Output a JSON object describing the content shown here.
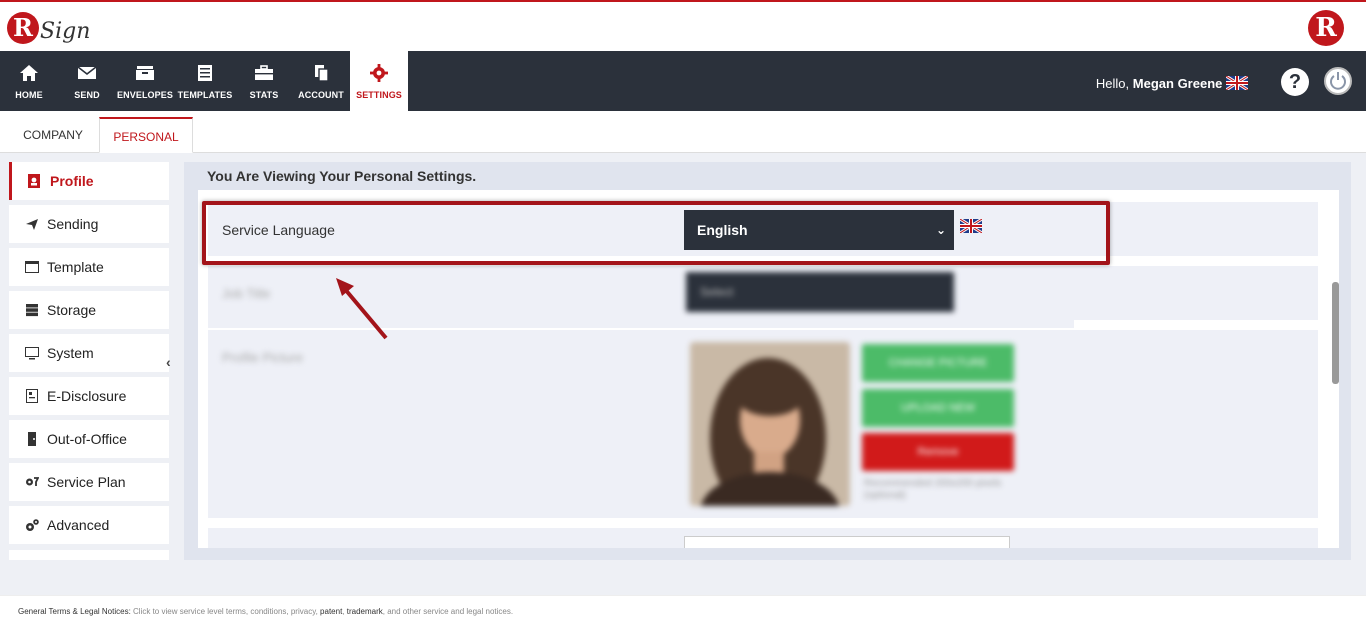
{
  "brand": {
    "left_logo_initial": "R",
    "left_logo_text": "Sign",
    "right_logo_initial": "R",
    "accent": "#c0171c"
  },
  "nav": {
    "items": [
      {
        "label": "HOME",
        "icon": "home-icon"
      },
      {
        "label": "SEND",
        "icon": "envelope-icon"
      },
      {
        "label": "ENVELOPES",
        "icon": "inbox-icon"
      },
      {
        "label": "TEMPLATES",
        "icon": "templates-icon"
      },
      {
        "label": "STATS",
        "icon": "briefcase-icon"
      },
      {
        "label": "ACCOUNT",
        "icon": "copy-icon"
      },
      {
        "label": "SETTINGS",
        "icon": "gear-icon",
        "active": true
      }
    ],
    "greeting": "Hello,",
    "user_name": "Megan Greene",
    "help_glyph": "?",
    "bg": "#2b313b"
  },
  "subtabs": {
    "company": "COMPANY",
    "personal": "PERSONAL"
  },
  "sidebar": {
    "items": [
      {
        "label": "Profile",
        "icon": "profile-icon",
        "active": true
      },
      {
        "label": "Sending",
        "icon": "paper-plane-icon"
      },
      {
        "label": "Template",
        "icon": "window-icon"
      },
      {
        "label": "Storage",
        "icon": "server-icon"
      },
      {
        "label": "System",
        "icon": "monitor-icon"
      },
      {
        "label": "E-Disclosure",
        "icon": "document-icon"
      },
      {
        "label": "Out-of-Office",
        "icon": "door-icon"
      },
      {
        "label": "Service Plan",
        "icon": "gears-icon"
      },
      {
        "label": "Advanced",
        "icon": "cogs-icon"
      }
    ],
    "collapse_glyph": "‹"
  },
  "main": {
    "title": "You Are Viewing Your Personal Settings.",
    "service_language": {
      "label": "Service Language",
      "value": "English"
    },
    "blurred": {
      "job_label": "Job Title",
      "job_value": "Select",
      "pic_label": "Profile Picture",
      "btn_change": "CHANGE PICTURE",
      "btn_upload": "UPLOAD NEW",
      "btn_remove": "Remove",
      "note": "Recommended 200x200 pixels (optional)"
    }
  },
  "footer": {
    "prefix": "General Terms & Legal Notices:",
    "text1": " Click to view service level terms, conditions, privacy, ",
    "patent": "patent",
    "comma": ", ",
    "trademark": "trademark",
    "text2": ", and other service and legal notices."
  }
}
